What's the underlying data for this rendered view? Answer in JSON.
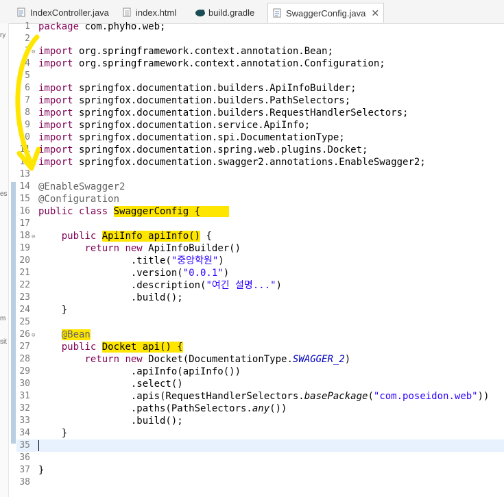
{
  "tabs": [
    {
      "label": "IndexController.java",
      "icon": "java-file-icon"
    },
    {
      "label": "index.html",
      "icon": "html-file-icon"
    },
    {
      "label": "build.gradle",
      "icon": "gradle-file-icon"
    },
    {
      "label": "SwaggerConfig.java",
      "icon": "java-file-icon",
      "active": true
    }
  ],
  "left_fragments": [
    "ry",
    "es",
    "m",
    "sit"
  ],
  "lines": [
    {
      "n": "1",
      "t": "package com.phyho.web;"
    },
    {
      "n": "2",
      "t": ""
    },
    {
      "n": "3",
      "t": "import org.springframework.context.annotation.Bean;"
    },
    {
      "n": "4",
      "t": "import org.springframework.context.annotation.Configuration;"
    },
    {
      "n": "5",
      "t": ""
    },
    {
      "n": "6",
      "t": "import springfox.documentation.builders.ApiInfoBuilder;"
    },
    {
      "n": "7",
      "t": "import springfox.documentation.builders.PathSelectors;"
    },
    {
      "n": "8",
      "t": "import springfox.documentation.builders.RequestHandlerSelectors;"
    },
    {
      "n": "9",
      "t": "import springfox.documentation.service.ApiInfo;"
    },
    {
      "n": "10",
      "t": "import springfox.documentation.spi.DocumentationType;"
    },
    {
      "n": "11",
      "t": "import springfox.documentation.spring.web.plugins.Docket;"
    },
    {
      "n": "12",
      "t": "import springfox.documentation.swagger2.annotations.EnableSwagger2;"
    },
    {
      "n": "13",
      "t": ""
    },
    {
      "n": "14",
      "t": "@EnableSwagger2"
    },
    {
      "n": "15",
      "t": "@Configuration"
    },
    {
      "n": "16",
      "t": "public class SwaggerConfig {"
    },
    {
      "n": "17",
      "t": ""
    },
    {
      "n": "18",
      "t": "    public ApiInfo apiInfo() {"
    },
    {
      "n": "19",
      "t": "        return new ApiInfoBuilder()"
    },
    {
      "n": "20",
      "t": "                .title(\"중앙학원\")"
    },
    {
      "n": "21",
      "t": "                .version(\"0.0.1\")"
    },
    {
      "n": "22",
      "t": "                .description(\"여긴 설명...\")"
    },
    {
      "n": "23",
      "t": "                .build();"
    },
    {
      "n": "24",
      "t": "    }"
    },
    {
      "n": "25",
      "t": ""
    },
    {
      "n": "26",
      "t": "    @Bean"
    },
    {
      "n": "27",
      "t": "    public Docket api() {"
    },
    {
      "n": "28",
      "t": "        return new Docket(DocumentationType.SWAGGER_2)"
    },
    {
      "n": "29",
      "t": "                .apiInfo(apiInfo())"
    },
    {
      "n": "30",
      "t": "                .select()"
    },
    {
      "n": "31",
      "t": "                .apis(RequestHandlerSelectors.basePackage(\"com.poseidon.web\"))"
    },
    {
      "n": "32",
      "t": "                .paths(PathSelectors.any())"
    },
    {
      "n": "33",
      "t": "                .build();"
    },
    {
      "n": "34",
      "t": "    }"
    },
    {
      "n": "35",
      "t": ""
    },
    {
      "n": "36",
      "t": ""
    },
    {
      "n": "37",
      "t": "}"
    },
    {
      "n": "38",
      "t": ""
    }
  ],
  "colors": {
    "keyword": "#7f0055",
    "annotation": "#646464",
    "string": "#2a00ff",
    "highlight": "#ffe600",
    "current_line": "#e8f2fe"
  }
}
